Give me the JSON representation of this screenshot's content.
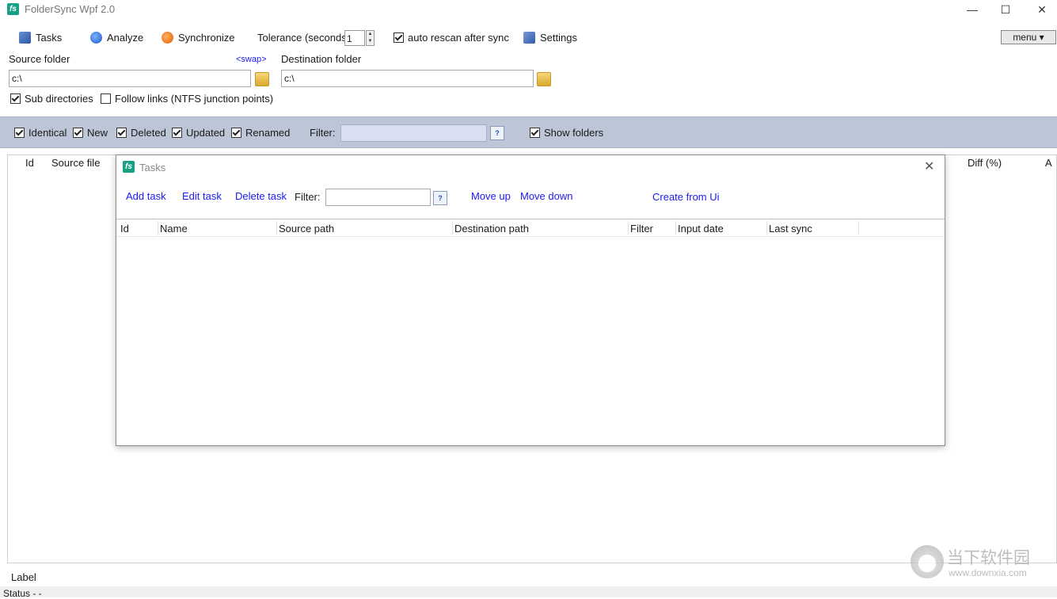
{
  "window": {
    "title": "FolderSync Wpf 2.0",
    "icon_letter": "fs",
    "minimize": "—",
    "maximize": "☐",
    "close": "✕"
  },
  "toolbar": {
    "tasks": "Tasks",
    "analyze": "Analyze",
    "synchronize": "Synchronize",
    "tolerance_label": "Tolerance (seconds",
    "tolerance_value": "1",
    "auto_rescan": "auto rescan after sync",
    "auto_rescan_checked": true,
    "settings": "Settings",
    "menu": "menu ▾"
  },
  "folders": {
    "source_label": "Source folder",
    "swap": "<swap>",
    "source_value": "c:\\",
    "destination_label": "Destination folder",
    "destination_value": "c:\\",
    "sub_directories": "Sub directories",
    "sub_directories_checked": true,
    "follow_links": "Follow links (NTFS junction points)",
    "follow_links_checked": false
  },
  "filterbar": {
    "identical": "Identical",
    "new": "New",
    "deleted": "Deleted",
    "updated": "Updated",
    "renamed": "Renamed",
    "filter_label": "Filter:",
    "filter_value": "",
    "help": "?",
    "show_folders": "Show folders"
  },
  "main_grid": {
    "columns": [
      "Id",
      "Source file",
      "Diff (%)",
      "A"
    ]
  },
  "tasks_dialog": {
    "title": "Tasks",
    "close": "✕",
    "add_task": "Add task",
    "edit_task": "Edit task",
    "delete_task": "Delete task",
    "filter_label": "Filter:",
    "filter_value": "",
    "help": "?",
    "move_up": "Move up",
    "move_down": "Move down",
    "create_from_ui": "Create from Ui",
    "columns": [
      "Id",
      "Name",
      "Source path",
      "Destination path",
      "Filter",
      "Input date",
      "Last sync"
    ]
  },
  "footer": {
    "label": "Label",
    "status": "Status  -  -"
  },
  "watermark": {
    "cn_text": "当下软件园",
    "url": "www.downxia.com"
  }
}
